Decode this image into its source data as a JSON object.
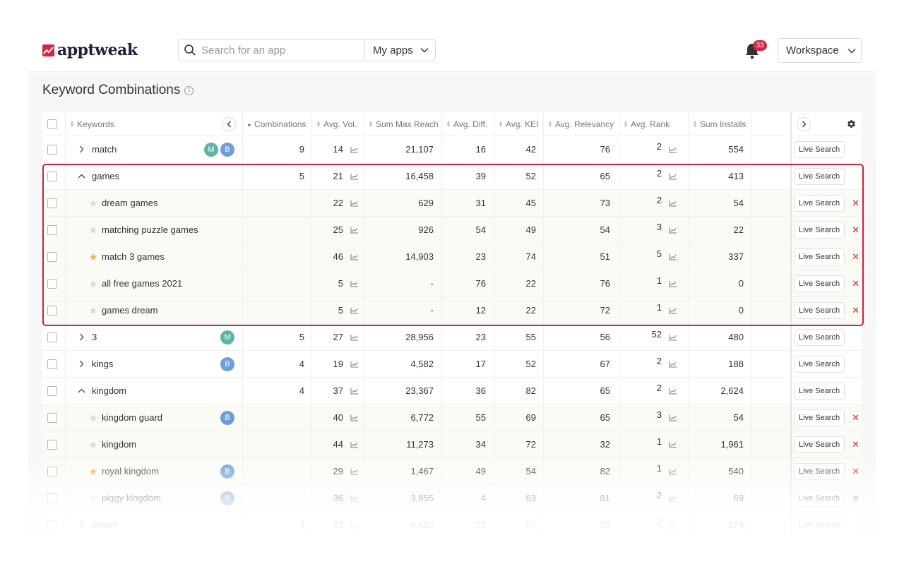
{
  "header": {
    "logo_text": "apptweak",
    "search_placeholder": "Search for an app",
    "myapps_label": "My apps",
    "notification_count": "33",
    "workspace_label": "Workspace"
  },
  "page": {
    "title": "Keyword Combinations"
  },
  "table": {
    "columns": {
      "keywords": "Keywords",
      "combinations": "Combinations",
      "avg_vol": "Avg. Vol.",
      "sum_max_reach": "Sum Max Reach",
      "avg_diff": "Avg. Diff.",
      "avg_kei": "Avg. KEI",
      "avg_relevancy": "Avg. Relevancy",
      "avg_rank": "Avg. Rank",
      "sum_installs": "Sum Installs"
    },
    "live_search_label": "Live Search",
    "rows": [
      {
        "type": "group",
        "expanded": false,
        "keyword": "match",
        "badges": [
          "M",
          "B"
        ],
        "combinations": "9",
        "vol": "14",
        "reach": "21,107",
        "diff": "16",
        "kei": "42",
        "rel": "76",
        "rank": "2",
        "installs": "554"
      },
      {
        "type": "group",
        "expanded": true,
        "keyword": "games",
        "badges": [],
        "combinations": "5",
        "vol": "21",
        "reach": "16,458",
        "diff": "39",
        "kei": "52",
        "rel": "65",
        "rank": "2",
        "installs": "413"
      },
      {
        "type": "sub",
        "starred": false,
        "keyword": "dream games",
        "badges": [],
        "vol": "22",
        "reach": "629",
        "diff": "31",
        "kei": "45",
        "rel": "73",
        "rank": "2",
        "installs": "54"
      },
      {
        "type": "sub",
        "starred": false,
        "keyword": "matching puzzle games",
        "badges": [],
        "vol": "25",
        "reach": "926",
        "diff": "54",
        "kei": "49",
        "rel": "54",
        "rank": "3",
        "installs": "22"
      },
      {
        "type": "sub",
        "starred": true,
        "keyword": "match 3 games",
        "badges": [],
        "vol": "46",
        "reach": "14,903",
        "diff": "23",
        "kei": "74",
        "rel": "51",
        "rank": "5",
        "installs": "337"
      },
      {
        "type": "sub",
        "starred": false,
        "keyword": "all free games 2021",
        "badges": [],
        "vol": "5",
        "reach": "-",
        "diff": "76",
        "kei": "22",
        "rel": "76",
        "rank": "1",
        "installs": "0"
      },
      {
        "type": "sub",
        "starred": false,
        "keyword": "games dream",
        "badges": [],
        "vol": "5",
        "reach": "-",
        "diff": "12",
        "kei": "22",
        "rel": "72",
        "rank": "1",
        "installs": "0"
      },
      {
        "type": "group",
        "expanded": false,
        "keyword": "3",
        "badges": [
          "M"
        ],
        "combinations": "5",
        "vol": "27",
        "reach": "28,956",
        "diff": "23",
        "kei": "55",
        "rel": "56",
        "rank": "52",
        "installs": "480"
      },
      {
        "type": "group",
        "expanded": false,
        "keyword": "kings",
        "badges": [
          "B"
        ],
        "combinations": "4",
        "vol": "19",
        "reach": "4,582",
        "diff": "17",
        "kei": "52",
        "rel": "67",
        "rank": "2",
        "installs": "188"
      },
      {
        "type": "group",
        "expanded": true,
        "keyword": "kingdom",
        "badges": [],
        "combinations": "4",
        "vol": "37",
        "reach": "23,367",
        "diff": "36",
        "kei": "82",
        "rel": "65",
        "rank": "2",
        "installs": "2,624"
      },
      {
        "type": "sub",
        "starred": false,
        "keyword": "kingdom guard",
        "badges": [
          "B"
        ],
        "vol": "40",
        "reach": "6,772",
        "diff": "55",
        "kei": "69",
        "rel": "65",
        "rank": "3",
        "installs": "54"
      },
      {
        "type": "sub",
        "starred": false,
        "keyword": "kingdom",
        "badges": [],
        "vol": "44",
        "reach": "11,273",
        "diff": "34",
        "kei": "72",
        "rel": "32",
        "rank": "1",
        "installs": "1,961"
      },
      {
        "type": "sub",
        "starred": true,
        "keyword": "royal kingdom",
        "badges": [
          "B"
        ],
        "vol": "29",
        "reach": "1,467",
        "diff": "49",
        "kei": "54",
        "rel": "82",
        "rank": "1",
        "installs": "540"
      },
      {
        "type": "sub",
        "starred": false,
        "keyword": "piggy kingdom",
        "badges": [
          "B"
        ],
        "vol": "36",
        "reach": "3,855",
        "diff": "4",
        "kei": "63",
        "rel": "81",
        "rank": "2",
        "installs": "69"
      },
      {
        "type": "group",
        "expanded": false,
        "keyword": "dream",
        "badges": [],
        "combinations": "3",
        "vol": "23",
        "reach": "9,680",
        "diff": "21",
        "kei": "57",
        "rel": "53",
        "rank": "2",
        "installs": "279"
      }
    ]
  },
  "colors": {
    "accent": "#d6263f",
    "badge_m": "#5bb5a6",
    "badge_b": "#6c9ed9",
    "star_on": "#f4b350",
    "star_off": "#d9d9d9"
  },
  "icons": {
    "search": "search-icon",
    "bell": "bell-icon",
    "settings": "gear-icon",
    "trend": "trend-chart-icon"
  }
}
